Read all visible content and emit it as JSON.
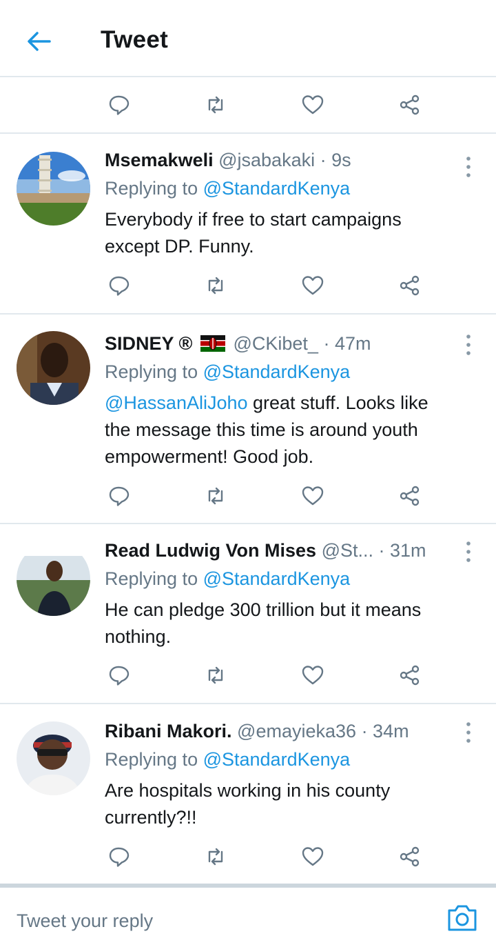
{
  "header": {
    "title": "Tweet"
  },
  "tweets": [
    {
      "name": "Msemakweli",
      "handle": "@jsabakaki",
      "time": "· 9s",
      "replying_prefix": "Replying to ",
      "replying_to": "@StandardKenya",
      "text_lines": [
        "Everybody if free to start campaigns",
        "except DP. Funny."
      ]
    },
    {
      "name": "SIDNEY ®",
      "flag": "kenya-flag-icon",
      "handle": "@CKibet_",
      "time": "· 47m",
      "replying_prefix": "Replying to ",
      "replying_to": "@StandardKenya",
      "mention": "@HassanAliJoho",
      "text_line1_rest": " great stuff. Looks like",
      "text_lines": [
        "the message this time is around youth",
        "empowerment! Good job."
      ]
    },
    {
      "name": "Read Ludwig Von Mises",
      "handle": "@St...",
      "time": "· 31m",
      "replying_prefix": "Replying to ",
      "replying_to": "@StandardKenya",
      "text_lines": [
        "He can pledge 300 trillion but it means",
        "nothing."
      ]
    },
    {
      "name": "Ribani Makori.",
      "handle": "@emayieka36",
      "time": "· 34m",
      "replying_prefix": "Replying to ",
      "replying_to": "@StandardKenya",
      "text_lines": [
        "Are hospitals working in his county",
        "currently?!!"
      ]
    }
  ],
  "composer": {
    "placeholder": "Tweet your reply"
  },
  "colors": {
    "accent": "#1b95e0",
    "muted": "#657786",
    "text": "#14171a",
    "divider": "#e1e8ed"
  }
}
